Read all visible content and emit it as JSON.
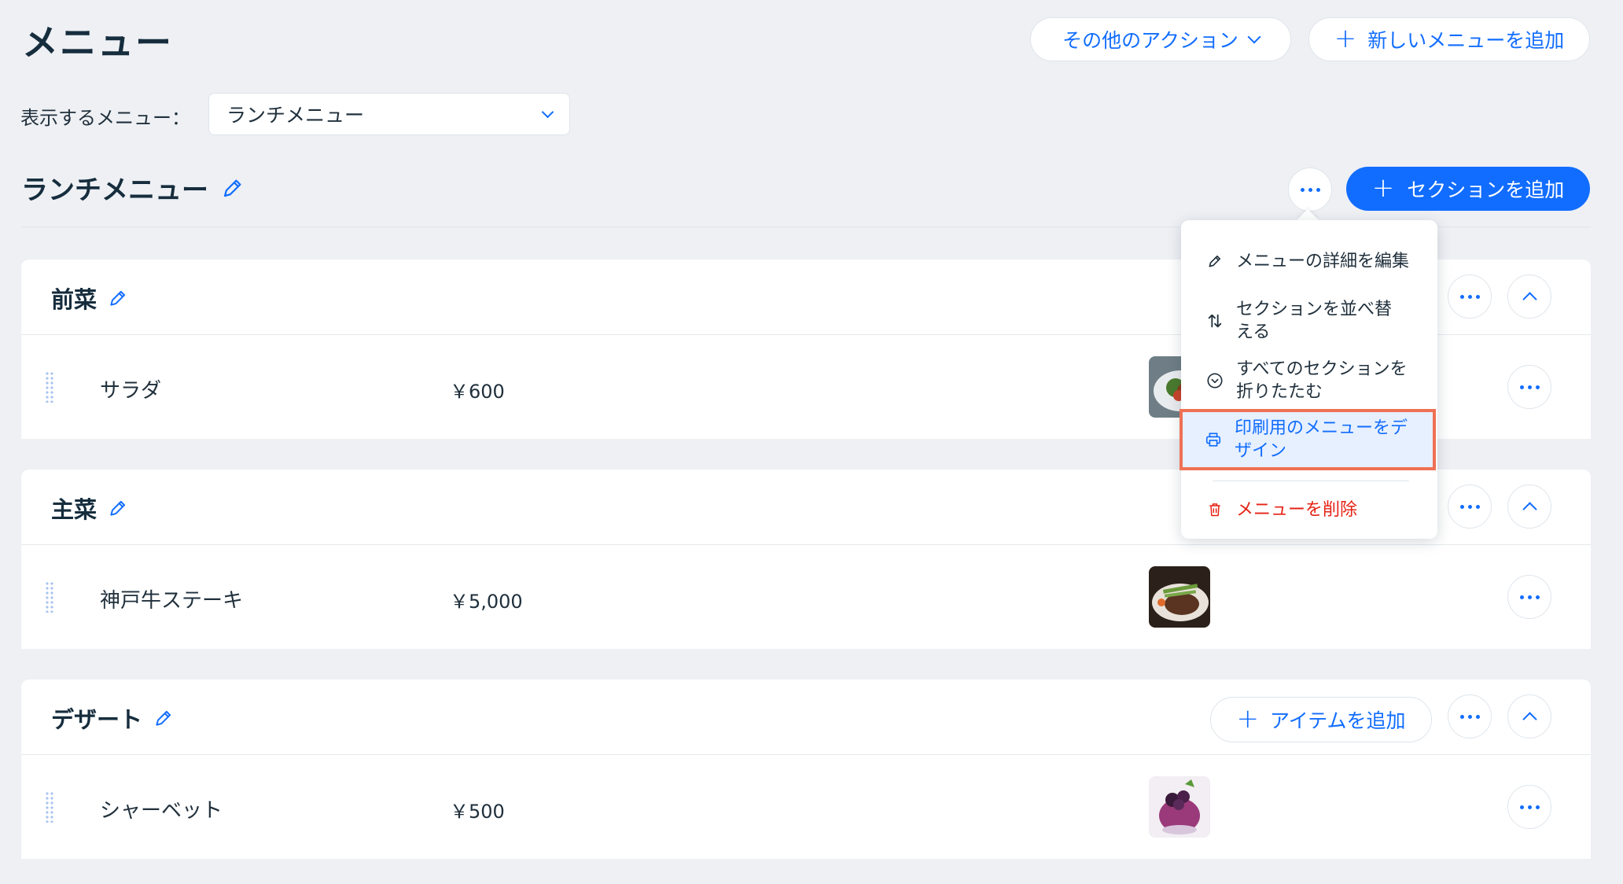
{
  "header": {
    "title": "メニュー",
    "more_actions_label": "その他のアクション",
    "add_menu_label": "新しいメニューを追加"
  },
  "menu_selector": {
    "label": "表示するメニュー：",
    "selected": "ランチメニュー"
  },
  "menu": {
    "title": "ランチメニュー",
    "add_section_label": "セクションを追加"
  },
  "sections": [
    {
      "title": "前菜",
      "items": [
        {
          "name": "サラダ",
          "price": "￥600"
        }
      ]
    },
    {
      "title": "主菜",
      "items": [
        {
          "name": "神戸牛ステーキ",
          "price": "￥5,000"
        }
      ]
    },
    {
      "title": "デザート",
      "add_item_label": "アイテムを追加",
      "items": [
        {
          "name": "シャーベット",
          "price": "￥500"
        }
      ]
    }
  ],
  "dropdown": {
    "items": [
      {
        "label": "メニューの詳細を編集",
        "icon": "pencil-icon"
      },
      {
        "label": "セクションを並べ替える",
        "icon": "sort-arrows-icon"
      },
      {
        "label": "すべてのセクションを折りたたむ",
        "icon": "collapse-circle-icon"
      },
      {
        "label": "印刷用のメニューをデザイン",
        "icon": "printer-icon"
      },
      {
        "label": "メニューを削除",
        "icon": "trash-icon"
      }
    ]
  },
  "colors": {
    "accent": "#116dff",
    "background": "#eef0f4",
    "danger": "#e62214",
    "highlight_border": "#ef7155"
  }
}
